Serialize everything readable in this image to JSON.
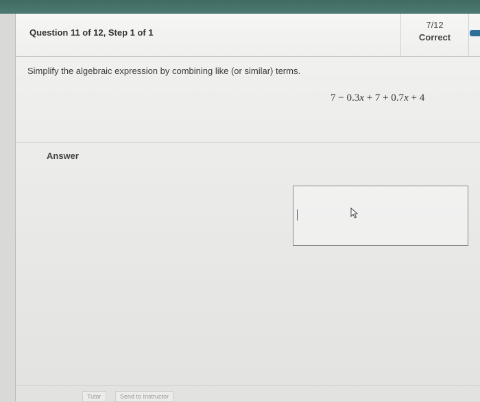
{
  "header": {
    "question_title": "Question 11 of 12, Step 1 of 1",
    "score_fraction": "7/12",
    "score_status": "Correct"
  },
  "question": {
    "instructions": "Simplify the algebraic expression by combining like (or similar) terms.",
    "expression": {
      "p1": "7 − 0.3",
      "v1": "x",
      "p2": " + 7 + 0.7",
      "v2": "x",
      "p3": " + 4"
    }
  },
  "answer": {
    "label": "Answer",
    "value": ""
  },
  "footer": {
    "tutor_label": "Tutor",
    "send_label": "Send to Instructor"
  },
  "colors": {
    "topbar": "#4c7a70",
    "side_tab": "#2e6f9a"
  }
}
